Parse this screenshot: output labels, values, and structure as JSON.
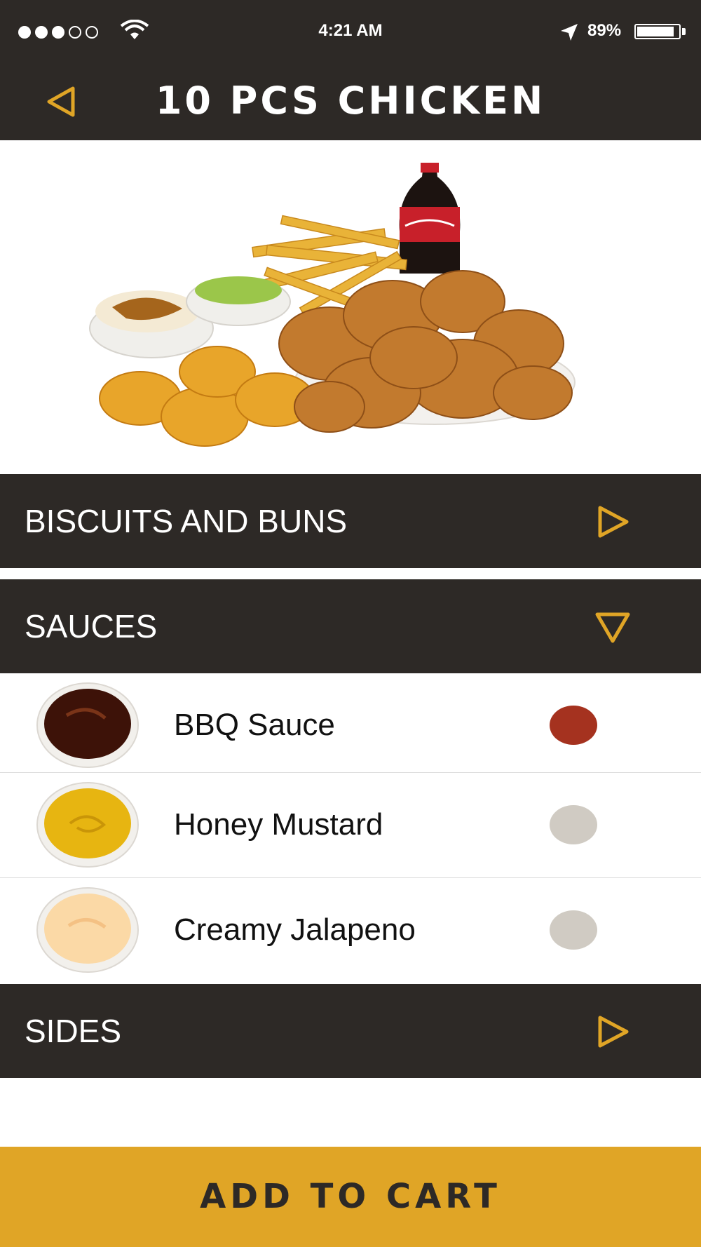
{
  "status_bar": {
    "time": "4:21 AM",
    "battery": "89%",
    "battery_level": 0.89,
    "signal_bars_filled": 3,
    "signal_bars_total": 5
  },
  "header": {
    "title": "10 PCS CHICKEN",
    "back_icon": "back-triangle-icon"
  },
  "hero": {
    "image": "chicken-combo-photo"
  },
  "sections": [
    {
      "label": "BISCUITS AND BUNS",
      "state": "collapsed"
    },
    {
      "label": "SAUCES",
      "state": "expanded"
    },
    {
      "label": "SIDES",
      "state": "collapsed"
    }
  ],
  "sauces": [
    {
      "name": "BBQ Sauce",
      "selected": true
    },
    {
      "name": "Honey Mustard",
      "selected": false
    },
    {
      "name": "Creamy Jalapeno",
      "selected": false
    }
  ],
  "cart": {
    "label": "ADD TO CART"
  },
  "colors": {
    "dark": "#2d2926",
    "accent": "#e0a526",
    "selected": "#a5321f",
    "unselected": "#d0cbc3"
  }
}
